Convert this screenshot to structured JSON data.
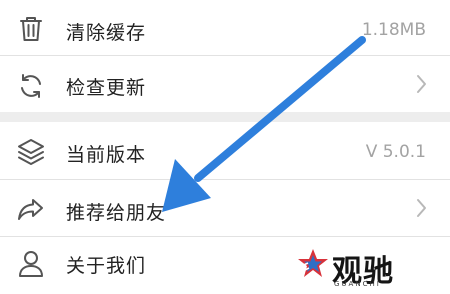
{
  "settings": {
    "items": [
      {
        "label": "清除缓存",
        "value": "1.18MB",
        "icon": "trash-icon"
      },
      {
        "label": "检查更新",
        "icon": "refresh-icon",
        "chevron": true
      },
      {
        "label": "当前版本",
        "value": "V 5.0.1",
        "icon": "layers-icon"
      },
      {
        "label": "推荐给朋友",
        "icon": "share-icon",
        "chevron": true
      },
      {
        "label": "关于我们",
        "icon": "user-icon"
      }
    ]
  },
  "annotation": {
    "arrow_color": "#2e7fdc"
  },
  "watermark": {
    "brand_cn": "观驰",
    "brand_en": "GUANCHI"
  },
  "colors": {
    "background": "#ededed",
    "row": "#ffffff",
    "secondary_text": "#a3a3a3"
  }
}
